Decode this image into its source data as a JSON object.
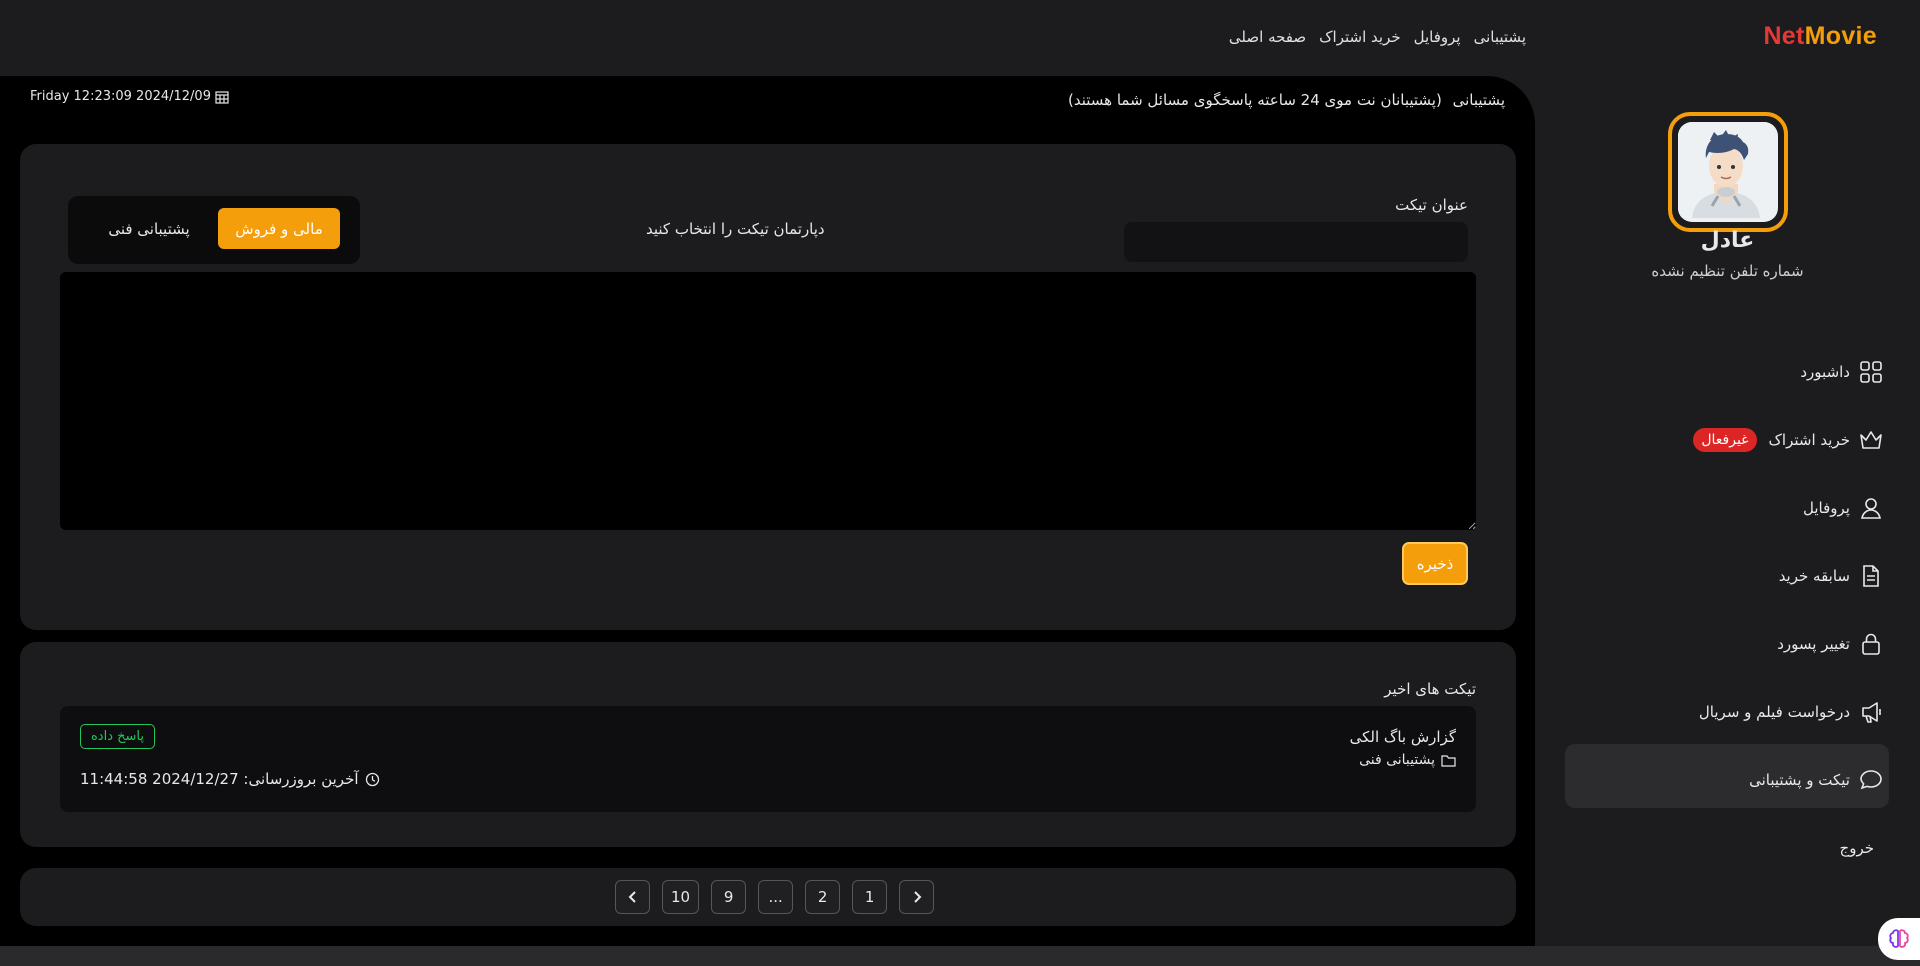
{
  "logo": {
    "net": "Net",
    "movie": "Movie"
  },
  "topnav": [
    "صفحه اصلی",
    "خرید اشتراک",
    "پروفایل",
    "پشتیبانی"
  ],
  "header": {
    "datetime": "Friday 12:23:09 2024/12/09",
    "page_title": "پشتیبانی",
    "page_subtitle": "(پشتیبانان نت موی 24 ساعته پاسخگوی مسائل شما هستند)"
  },
  "ticket_form": {
    "title_label": "عنوان تیکت",
    "title_value": "",
    "department_label": "دپارتمان تیکت را انتخاب کنید",
    "department_active": "مالی و فروش",
    "department_other": "پشتیبانی فنی",
    "message_value": "",
    "save_label": "ذخیره"
  },
  "recent": {
    "title": "تیکت های اخیر",
    "tickets": [
      {
        "subject": "گزارش باگ الکی",
        "department": "پشتیبانی فنی",
        "status": "پاسخ داده",
        "updated": "آخرین بروزرسانی: 2024/12/27 11:44:58"
      }
    ]
  },
  "pagination": {
    "pages": [
      "1",
      "2",
      "...",
      "9",
      "10"
    ]
  },
  "user": {
    "name": "عادل",
    "phone": "شماره تلفن تنظیم نشده"
  },
  "sidebar": {
    "items": [
      {
        "label": "داشبورد",
        "icon": "grid-icon"
      },
      {
        "label": "خرید اشتراک",
        "icon": "crown-icon",
        "badge": "غیرفعال"
      },
      {
        "label": "پروفایل",
        "icon": "user-icon"
      },
      {
        "label": "سابقه خرید",
        "icon": "document-icon"
      },
      {
        "label": "تغییر پسورد",
        "icon": "lock-icon"
      },
      {
        "label": "درخواست فیلم و سریال",
        "icon": "megaphone-icon"
      },
      {
        "label": "تیکت و پشتیبانی",
        "icon": "chat-icon",
        "active": true
      },
      {
        "label": "خروج"
      }
    ]
  },
  "colors": {
    "accent": "#f59e0b",
    "danger": "#dc2626",
    "success": "#22c55e"
  }
}
